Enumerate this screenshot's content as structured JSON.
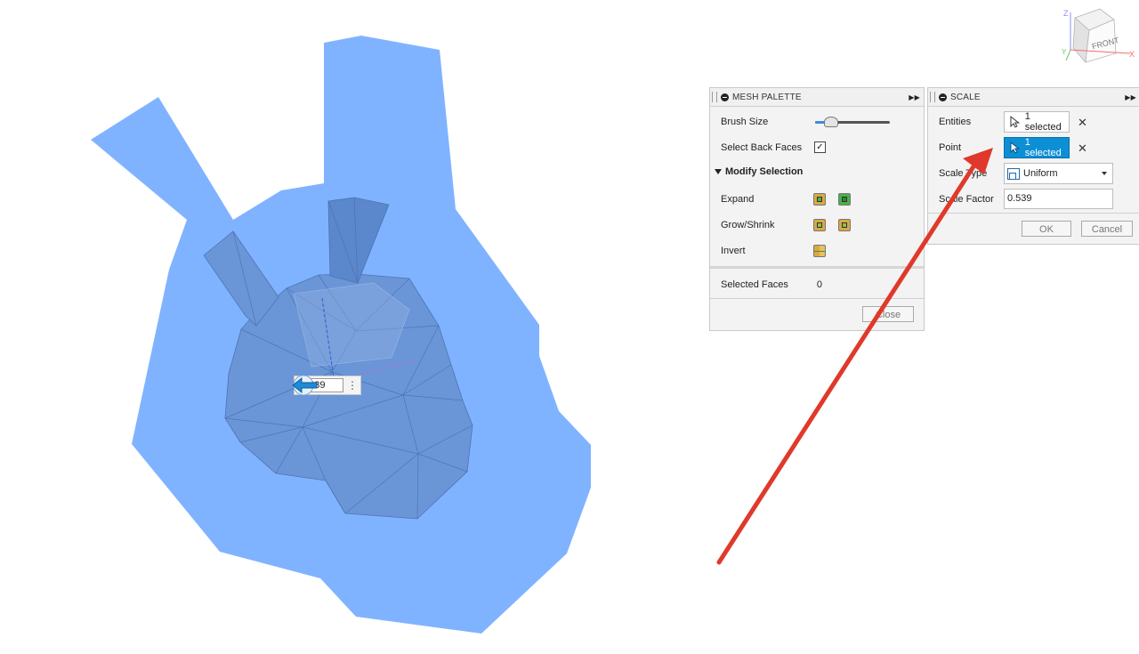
{
  "manipulator": {
    "value": "0.539",
    "menu_glyph": "⋮"
  },
  "mesh_palette": {
    "title": "MESH PALETTE",
    "brush_size_label": "Brush Size",
    "brush_size_fraction": 0.2,
    "select_back_faces_label": "Select Back Faces",
    "select_back_faces_checked": true,
    "modify_selection_label": "Modify Selection",
    "expand_label": "Expand",
    "grow_shrink_label": "Grow/Shrink",
    "invert_label": "Invert",
    "selected_faces_label": "Selected Faces",
    "selected_faces_value": "0",
    "close_label": "Close"
  },
  "scale": {
    "title": "SCALE",
    "entities_label": "Entities",
    "entities_value": "1 selected",
    "point_label": "Point",
    "point_value": "1 selected",
    "scale_type_label": "Scale Type",
    "scale_type_value": "Uniform",
    "scale_factor_label": "Scale Factor",
    "scale_factor_value": "0.539",
    "ok_label": "OK",
    "cancel_label": "Cancel",
    "clear_glyph": "✕"
  },
  "viewcube": {
    "face_label": "FRONT",
    "axis_z": "Z",
    "axis_x": "X",
    "axis_y": "Y"
  },
  "colors": {
    "mesh_fill": "#80b3ff",
    "mesh_body": "#6a96d8",
    "selection_blue": "#0d8fd6",
    "annotation_arrow": "#e0392b"
  }
}
